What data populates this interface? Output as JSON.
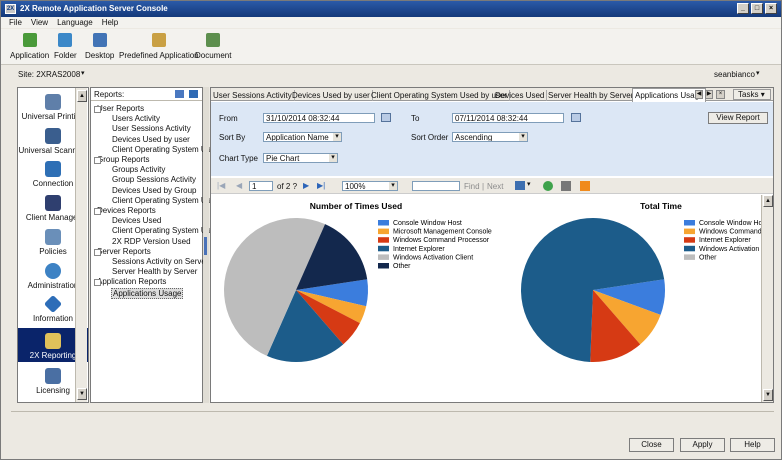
{
  "window": {
    "title": "2X Remote Application Server Console",
    "icon_text": "2X"
  },
  "menu": [
    "File",
    "View",
    "Language",
    "Help"
  ],
  "toolbar": [
    {
      "label": "Application",
      "icon": "application-icon",
      "color": "#4a9a3a"
    },
    {
      "label": "Folder",
      "icon": "folder-icon",
      "color": "#3b88c8"
    },
    {
      "label": "Desktop",
      "icon": "desktop-icon",
      "color": "#4274b6"
    },
    {
      "label": "Predefined Application",
      "icon": "predefined-application-icon",
      "color": "#c9a043"
    },
    {
      "label": "Document",
      "icon": "document-icon",
      "color": "#5d8f4e"
    }
  ],
  "site": {
    "label": "Site: 2XRAS2008",
    "user": "seanbianco"
  },
  "nav": [
    {
      "label": "Universal Printing",
      "icon": "printer-icon"
    },
    {
      "label": "Universal Scanning",
      "icon": "scanner-icon"
    },
    {
      "label": "Connection",
      "icon": "connection-icon"
    },
    {
      "label": "Client Manager",
      "icon": "client-manager-icon"
    },
    {
      "label": "Policies",
      "icon": "policies-icon"
    },
    {
      "label": "Administration",
      "icon": "administration-icon"
    },
    {
      "label": "Information",
      "icon": "information-icon"
    },
    {
      "label": "2X Reporting",
      "icon": "reporting-icon",
      "selected": true
    },
    {
      "label": "Licensing",
      "icon": "licensing-icon"
    }
  ],
  "reports": {
    "header": "Reports:",
    "tree": [
      {
        "type": "group",
        "label": "User Reports"
      },
      {
        "type": "leaf",
        "label": "Users Activity"
      },
      {
        "type": "leaf",
        "label": "User Sessions Activity"
      },
      {
        "type": "leaf",
        "label": "Devices Used by user"
      },
      {
        "type": "leaf",
        "label": "Client Operating System Used"
      },
      {
        "type": "group",
        "label": "Group Reports"
      },
      {
        "type": "leaf",
        "label": "Groups Activity"
      },
      {
        "type": "leaf",
        "label": "Group Sessions Activity"
      },
      {
        "type": "leaf",
        "label": "Devices Used by Group"
      },
      {
        "type": "leaf",
        "label": "Client Operating System Used"
      },
      {
        "type": "group",
        "label": "Devices Reports"
      },
      {
        "type": "leaf",
        "label": "Devices Used"
      },
      {
        "type": "leaf",
        "label": "Client Operating System Used"
      },
      {
        "type": "leaf",
        "label": "2X RDP Version Used"
      },
      {
        "type": "group",
        "label": "Server Reports"
      },
      {
        "type": "leaf",
        "label": "Sessions Activity on Server"
      },
      {
        "type": "leaf",
        "label": "Server Health by Server"
      },
      {
        "type": "group",
        "label": "Application Reports"
      },
      {
        "type": "leaf",
        "label": "Applications Usage",
        "selected": true
      }
    ]
  },
  "tabs": [
    "User Sessions Activity",
    "Devices Used by user",
    "Client Operating System Used by user",
    "Devices Used",
    "Server Health by Server",
    "Applications Usage"
  ],
  "tasks_label": "Tasks",
  "params": {
    "from_label": "From",
    "from_value": "31/10/2014 08:32:44",
    "to_label": "To",
    "to_value": "07/11/2014 08:32:44",
    "sortby_label": "Sort By",
    "sortby_value": "Application Name",
    "sortorder_label": "Sort Order",
    "sortorder_value": "Ascending",
    "charttype_label": "Chart Type",
    "charttype_value": "Pie Chart",
    "view_report": "View Report"
  },
  "report_toolbar": {
    "page": "1",
    "of": "of 2 ?",
    "zoom": "100%",
    "find": "Find",
    "next": "Next",
    "separator": "|"
  },
  "chart_data": [
    {
      "type": "pie",
      "title": "Number of Times Used",
      "categories": [
        "Console Window Host",
        "Microsoft Management Console",
        "Windows Command Processor",
        "Internet Explorer",
        "Windows Activation Client",
        "Other"
      ],
      "values": [
        6,
        4,
        6,
        18,
        50,
        16
      ],
      "colors": [
        "#3b7ddd",
        "#f7a531",
        "#d63a14",
        "#1c5c8a",
        "#bdbdbd",
        "#13284d"
      ]
    },
    {
      "type": "pie",
      "title": "Total Time",
      "categories": [
        "Console Window Host",
        "Windows Command P",
        "Internet Explorer",
        "Windows Activation C",
        "Other"
      ],
      "values": [
        8,
        8,
        12,
        72,
        0
      ],
      "colors": [
        "#3b7ddd",
        "#f7a531",
        "#d63a14",
        "#1c5c8a",
        "#bdbdbd"
      ]
    }
  ],
  "buttons": {
    "close": "Close",
    "apply": "Apply",
    "help": "Help"
  }
}
